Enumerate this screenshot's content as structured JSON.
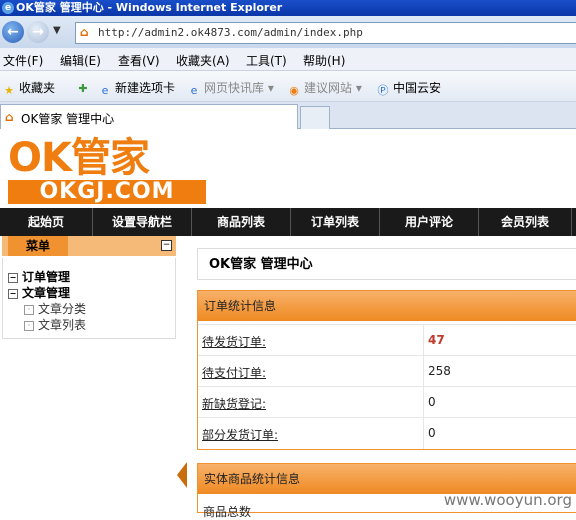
{
  "window": {
    "title": "OK管家 管理中心 - Windows Internet Explorer"
  },
  "address": {
    "url": "http://admin2.ok4873.com/admin/index.php"
  },
  "menu": [
    "文件(F)",
    "编辑(E)",
    "查看(V)",
    "收藏夹(A)",
    "工具(T)",
    "帮助(H)"
  ],
  "favorites": {
    "label": "收藏夹",
    "items": [
      "新建选项卡",
      "网页快讯库",
      "建议网站",
      "中国云安"
    ]
  },
  "tab": {
    "title": "OK管家 管理中心"
  },
  "logo": {
    "line1": "OK管家",
    "line2": "OKGJ.COM"
  },
  "nav": [
    "起始页",
    "设置导航栏",
    "商品列表",
    "订单列表",
    "用户评论",
    "会员列表"
  ],
  "sidebar": {
    "header": "菜单",
    "tree": [
      {
        "label": "订单管理",
        "level": 0
      },
      {
        "label": "文章管理",
        "level": 0
      },
      {
        "label": "文章分类",
        "level": 1
      },
      {
        "label": "文章列表",
        "level": 1
      }
    ]
  },
  "main": {
    "title": "OK管家 管理中心",
    "panel1": {
      "heading": "订单统计信息",
      "rows": [
        {
          "label": "待发货订单:",
          "value": "47"
        },
        {
          "label": "待支付订单:",
          "value": "258"
        },
        {
          "label": "新缺货登记:",
          "value": "0"
        },
        {
          "label": "部分发货订单:",
          "value": "0"
        }
      ]
    },
    "panel2": {
      "heading": "实体商品统计信息",
      "partial_row": "商品总数"
    }
  },
  "watermark": "www.wooyun.org",
  "colors": {
    "accent": "#ef7d10",
    "nav_bg": "#1a1a1a",
    "titlebar": "#0a36a8"
  }
}
